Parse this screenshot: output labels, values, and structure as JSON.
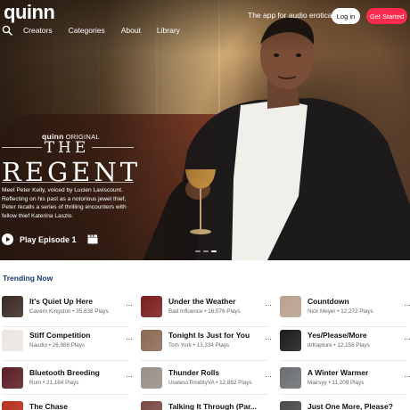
{
  "header": {
    "logo": "quinn",
    "tagline": "The app for audio erotica",
    "login": "Log in",
    "get_started": "Get Started"
  },
  "nav": {
    "search_icon": "search-icon",
    "items": [
      "Creators",
      "Categories",
      "About",
      "Library"
    ]
  },
  "feature": {
    "brand": "quinn",
    "badge": "ORIGINAL",
    "title_small": "THE",
    "title_large": "REGENT",
    "description": "Meet Peter Kelly, voiced by Lucien Laviscount. Reflecting on his past as a notorious jewel thief, Peter recalls a series of thrilling encounters with fellow thief Katerina Laszlo.",
    "play_label": "Play Episode 1",
    "play_icon": "play-circle-icon",
    "extra_icon": "clapperboard-icon",
    "active_slide": 3,
    "slide_count": 3
  },
  "trending": {
    "title": "Trending Now",
    "items": [
      {
        "name": "It's Quiet Up Here",
        "creator": "Cavern Kingston",
        "plays": "35,638 Plays",
        "thumb": "#3a2a24"
      },
      {
        "name": "Under the Weather",
        "creator": "Bad Influence",
        "plays": "16,576 Plays",
        "thumb": "#7a1e1e"
      },
      {
        "name": "Countdown",
        "creator": "Nick Meyer",
        "plays": "12,272 Plays",
        "thumb": "#b9a18c"
      },
      {
        "name": "Stiff Competition",
        "creator": "Naudio",
        "plays": "26,988 Plays",
        "thumb": "#ece6e2"
      },
      {
        "name": "Tonight Is Just for You",
        "creator": "Tom York",
        "plays": "13,334 Plays",
        "thumb": "#8a6a55"
      },
      {
        "name": "Yes/Please/More",
        "creator": "drKapture",
        "plays": "12,156 Plays",
        "thumb": "#1c1c1c"
      },
      {
        "name": "Bluetooth Breeding",
        "creator": "Rum",
        "plays": "21,184 Plays",
        "thumb": "#5a1e24"
      },
      {
        "name": "Thunder Rolls",
        "creator": "UselessTimidityVA",
        "plays": "12,882 Plays",
        "thumb": "#9a8e8a"
      },
      {
        "name": "A Winter Warmer",
        "creator": "Mairsyy",
        "plays": "11,209 Plays",
        "thumb": "#6b6e72"
      },
      {
        "name": "The Chase",
        "creator": "",
        "plays": "",
        "thumb": "#b9301e"
      },
      {
        "name": "Talking It Through (Par...",
        "creator": "",
        "plays": "",
        "thumb": "#7a4a44"
      },
      {
        "name": "Just One More, Please?",
        "creator": "",
        "plays": "",
        "thumb": "#4a4a4a"
      }
    ]
  },
  "colors": {
    "accent": "#ff2b4f",
    "trending_title": "#133a6e"
  }
}
